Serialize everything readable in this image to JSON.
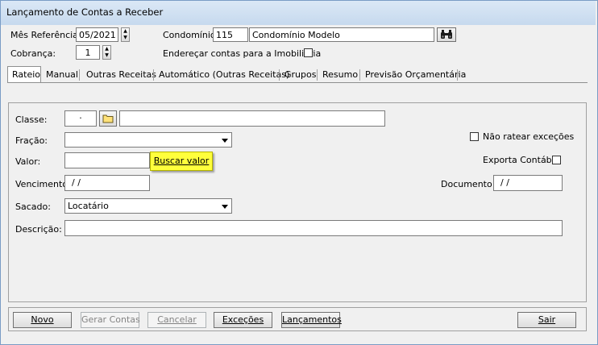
{
  "window": {
    "title": "Lançamento de Contas a Receber"
  },
  "header": {
    "mes_referencia_label": "Mês Referência:",
    "mes_referencia_value": "05/2021",
    "condominio_label": "Condomínio:",
    "condominio_code": "115",
    "condominio_name": "Condomínio Modelo",
    "cobranca_label": "Cobrança:",
    "cobranca_value": "1",
    "enderecar_label": "Endereçar contas para a Imobiliária",
    "enderecar_checked": false
  },
  "tabs": [
    {
      "label": "Rateio",
      "active": true
    },
    {
      "label": "Manual",
      "active": false
    },
    {
      "label": "Outras Receitas",
      "active": false
    },
    {
      "label": "Automático (Outras Receitas)",
      "active": false
    },
    {
      "label": "Grupos",
      "active": false
    },
    {
      "label": "Resumo",
      "active": false
    },
    {
      "label": "Previsão Orçamentária",
      "active": false
    }
  ],
  "form": {
    "classe_label": "Classe:",
    "classe_code": "·",
    "classe_desc": "",
    "fracao_label": "Fração:",
    "fracao_value": "",
    "valor_label": "Valor:",
    "valor_value": "",
    "buscar_valor_label": "Buscar valor",
    "vencimento_label": "Vencimento:",
    "vencimento_value": "/ /",
    "sacado_label": "Sacado:",
    "sacado_value": "Locatário",
    "descricao_label": "Descrição:",
    "descricao_value": "",
    "nao_ratear_label": "Não ratear exceções",
    "nao_ratear_checked": false,
    "exporta_contabil_label": "Exporta Contábil",
    "exporta_contabil_checked": false,
    "documento_label": "Documento:",
    "documento_value": "/ /"
  },
  "buttons": {
    "novo": "Novo",
    "gerar_contas": "Gerar Contas",
    "cancelar": "Cancelar",
    "excecoes": "Exceções",
    "lancamentos": "Lançamentos",
    "sair": "Sair"
  },
  "colors": {
    "tooltip_bg": "#ffff3c",
    "window_bg": "#f0f0f0",
    "title_bg": "#c6d9ee"
  },
  "icons": {
    "folder": "folder-icon",
    "binoculars": "binoculars-icon"
  }
}
